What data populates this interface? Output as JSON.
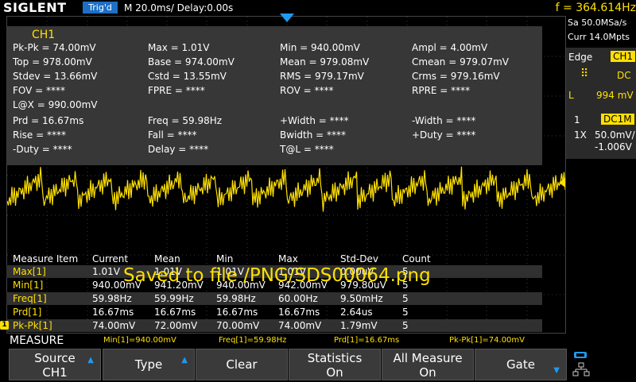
{
  "topbar": {
    "brand": "SIGLENT",
    "trigger_status": "Trig'd",
    "timebase": "M 20.0ms/ Delay:0.00s",
    "frequency": "f = 364.614Hz"
  },
  "right_panel": {
    "sample_rate": "Sa 50.0MSa/s",
    "memory": "Curr 14.0Mpts",
    "trigger_type": "Edge",
    "trigger_source": "CH1",
    "coupling": "DC",
    "level_label": "L",
    "level": "994 mV",
    "channel": "1",
    "channel_coupling": "DC1M",
    "probe": "1X",
    "volts_div": "50.0mV/",
    "offset": "-1.006V"
  },
  "measure_panel": {
    "channel_label": "CH1",
    "rows": [
      [
        "Pk-Pk = 74.00mV",
        "Max = 1.01V",
        "Min = 940.00mV",
        "Ampl = 4.00mV"
      ],
      [
        "Top = 978.00mV",
        "Base = 974.00mV",
        "Mean = 979.08mV",
        "Cmean = 979.07mV"
      ],
      [
        "Stdev = 13.66mV",
        "Cstd = 13.55mV",
        "RMS = 979.17mV",
        "Crms = 979.16mV"
      ],
      [
        "FOV = ****",
        "FPRE = ****",
        "ROV = ****",
        "RPRE = ****"
      ],
      [
        "L@X = 990.00mV",
        "",
        "",
        ""
      ],
      [
        "Prd = 16.67ms",
        "Freq = 59.98Hz",
        "+Width = ****",
        "-Width = ****"
      ],
      [
        "Rise = ****",
        "Fall = ****",
        "Bwidth = ****",
        "+Duty = ****"
      ],
      [
        "-Duty = ****",
        "Delay = ****",
        "T@L = ****",
        ""
      ]
    ]
  },
  "stats_table": {
    "headers": [
      "Measure Item",
      "Current",
      "Mean",
      "Min",
      "Max",
      "Std-Dev",
      "Count"
    ],
    "rows": [
      [
        "Max[1]",
        "1.01V",
        "1.01V",
        "1.01V",
        "1.01V",
        "0.00uV",
        "5"
      ],
      [
        "Min[1]",
        "940.00mV",
        "941.20mV",
        "940.00mV",
        "942.00mV",
        "979.80uV",
        "5"
      ],
      [
        "Freq[1]",
        "59.98Hz",
        "59.99Hz",
        "59.98Hz",
        "60.00Hz",
        "9.50mHz",
        "5"
      ],
      [
        "Prd[1]",
        "16.67ms",
        "16.67ms",
        "16.67ms",
        "16.67ms",
        "2.64us",
        "5"
      ],
      [
        "Pk-Pk[1]",
        "74.00mV",
        "72.00mV",
        "70.00mV",
        "74.00mV",
        "1.79mV",
        "5"
      ]
    ]
  },
  "saved_message": "Saved to file /PNG/SDS00064.png",
  "channel_marker": "1",
  "measure_strip": {
    "title": "MEASURE",
    "items": [
      "Min[1]=940.00mV",
      "Freq[1]=59.98Hz",
      "Prd[1]=16.67ms",
      "Pk-Pk[1]=74.00mV"
    ]
  },
  "softkeys": [
    {
      "line1": "Source",
      "line2": "CH1"
    },
    {
      "line1": "Type",
      "line2": ""
    },
    {
      "line1": "Clear",
      "line2": ""
    },
    {
      "line1": "Statistics",
      "line2": "On"
    },
    {
      "line1": "All Measure",
      "line2": "On"
    },
    {
      "line1": "Gate",
      "line2": ""
    }
  ],
  "colors": {
    "channel1": "#ffe000",
    "accent_blue": "#1e6fc6",
    "panel_gray": "#3c3c3c"
  }
}
